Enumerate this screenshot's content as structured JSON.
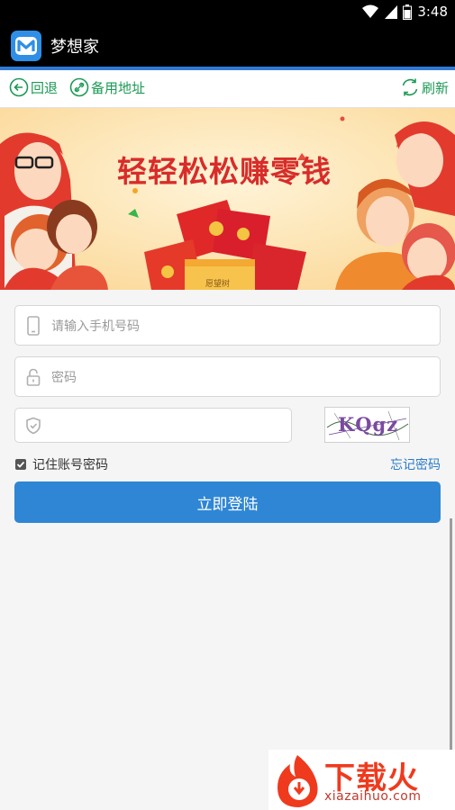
{
  "status_bar": {
    "time": "3:48"
  },
  "app": {
    "title": "梦想家",
    "logo_letter": "M"
  },
  "toolbar": {
    "back_label": "回退",
    "backup_label": "备用地址",
    "refresh_label": "刷新"
  },
  "banner": {
    "headline": "轻轻松松赚零钱",
    "package_label": "愿望树"
  },
  "form": {
    "phone_placeholder": "请输入手机号码",
    "password_placeholder": "密码",
    "captcha_value": "",
    "captcha_text": "KQgz",
    "remember_label": "记住账号密码",
    "remember_checked": true,
    "forgot_label": "忘记密码",
    "login_label": "立即登陆"
  },
  "watermark": {
    "brand": "下载火",
    "url": "xiazaihuo.com"
  },
  "colors": {
    "accent": "#2f86d4",
    "toolbar_green": "#1c9a55",
    "banner_red": "#d82c2a"
  }
}
